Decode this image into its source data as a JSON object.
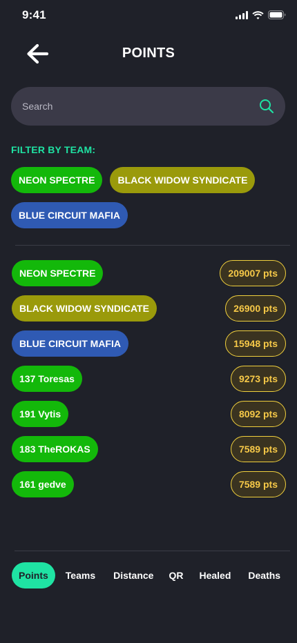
{
  "status_bar": {
    "time": "9:41"
  },
  "header": {
    "title": "POINTS"
  },
  "search": {
    "placeholder": "Search"
  },
  "filter": {
    "label": "FILTER BY TEAM:",
    "teams": [
      {
        "name": "NEON SPECTRE",
        "color": "#13b80a"
      },
      {
        "name": "BLACK WIDOW SYNDICATE",
        "color": "#9a9a0b"
      },
      {
        "name": "BLUE CIRCUIT MAFIA",
        "color": "#2f5ab3"
      }
    ]
  },
  "ranking": [
    {
      "name": "NEON SPECTRE",
      "points": "209007 pts",
      "color": "#13b80a"
    },
    {
      "name": "BLACK WIDOW SYNDICATE",
      "points": "26900 pts",
      "color": "#9a9a0b"
    },
    {
      "name": "BLUE CIRCUIT MAFIA",
      "points": "15948 pts",
      "color": "#2f5ab3"
    },
    {
      "name": "137 Toresas",
      "points": "9273 pts",
      "color": "#13b80a"
    },
    {
      "name": "191 Vytis",
      "points": "8092 pts",
      "color": "#13b80a"
    },
    {
      "name": "183 TheROKAS",
      "points": "7589 pts",
      "color": "#13b80a"
    },
    {
      "name": "161 gedve",
      "points": "7589 pts",
      "color": "#13b80a"
    }
  ],
  "tabs": [
    {
      "label": "Points",
      "active": true
    },
    {
      "label": "Teams",
      "active": false
    },
    {
      "label": "Distance",
      "active": false
    },
    {
      "label": "QR",
      "active": false
    },
    {
      "label": "Healed",
      "active": false
    },
    {
      "label": "Deaths",
      "active": false
    }
  ],
  "colors": {
    "background": "#1f2129",
    "accent": "#1fe3a3",
    "points_text": "#f7c948",
    "points_border": "#f2d13d",
    "search_bg": "#3b3a48"
  },
  "icons": {
    "back": "back-arrow-icon",
    "search": "search-icon",
    "signal": "cellular-signal-icon",
    "wifi": "wifi-icon",
    "battery": "battery-icon"
  }
}
